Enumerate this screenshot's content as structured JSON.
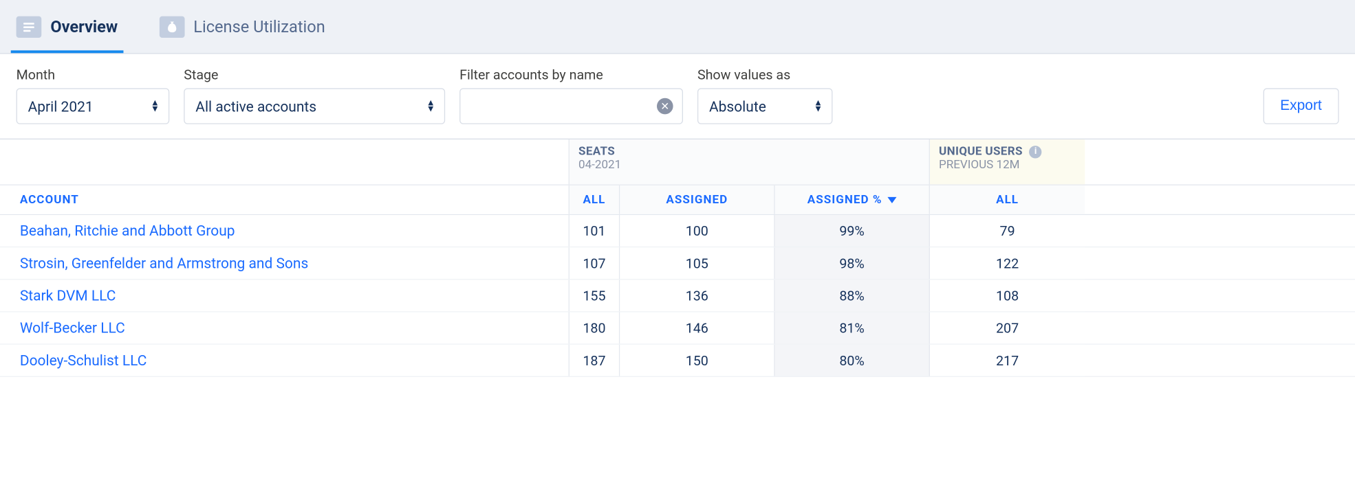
{
  "tabs": {
    "overview": "Overview",
    "license": "License Utilization"
  },
  "filters": {
    "month_label": "Month",
    "month_value": "April 2021",
    "stage_label": "Stage",
    "stage_value": "All active accounts",
    "name_label": "Filter accounts by name",
    "show_label": "Show values as",
    "show_value": "Absolute",
    "export_label": "Export"
  },
  "headers": {
    "account": "ACCOUNT",
    "seats_title": "SEATS",
    "seats_sub": "04-2021",
    "unique_title": "UNIQUE USERS",
    "unique_sub": "PREVIOUS 12M",
    "all": "ALL",
    "assigned": "ASSIGNED",
    "assigned_pct": "ASSIGNED %"
  },
  "rows": [
    {
      "name": "Beahan, Ritchie and Abbott Group",
      "all": "101",
      "assigned": "100",
      "pct": "99%",
      "uall": "79"
    },
    {
      "name": "Strosin, Greenfelder and Armstrong and Sons",
      "all": "107",
      "assigned": "105",
      "pct": "98%",
      "uall": "122"
    },
    {
      "name": "Stark DVM LLC",
      "all": "155",
      "assigned": "136",
      "pct": "88%",
      "uall": "108"
    },
    {
      "name": "Wolf-Becker LLC",
      "all": "180",
      "assigned": "146",
      "pct": "81%",
      "uall": "207"
    },
    {
      "name": "Dooley-Schulist LLC",
      "all": "187",
      "assigned": "150",
      "pct": "80%",
      "uall": "217"
    }
  ]
}
